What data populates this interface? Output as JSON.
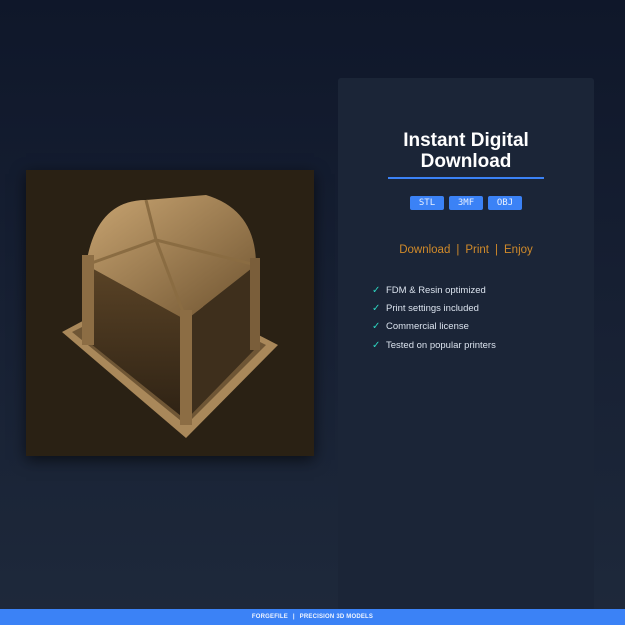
{
  "product": {
    "image_alt": "Gothic shrine 3D model render"
  },
  "panel": {
    "title_line1": "Instant Digital",
    "title_line2": "Download",
    "formats": [
      "STL",
      "3MF",
      "OBJ"
    ],
    "tagline": [
      "Download",
      "Print",
      "Enjoy"
    ],
    "tagline_separator": "|",
    "features": [
      "FDM & Resin optimized",
      "Print settings included",
      "Commercial license",
      "Tested on popular printers"
    ],
    "check_glyph": "✓"
  },
  "footer": {
    "brand": "FORGEFILE",
    "separator": "|",
    "text": "PRECISION 3D MODELS"
  },
  "colors": {
    "accent": "#3b82f6",
    "tagline": "#d08a2a",
    "check": "#2dd4bf"
  }
}
